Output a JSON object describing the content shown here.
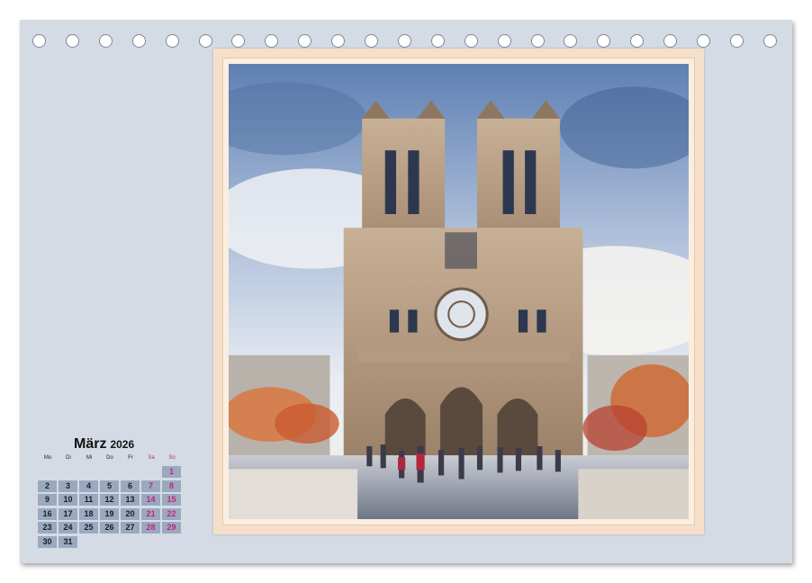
{
  "calendar": {
    "month": "März",
    "year": "2026",
    "weekdays": [
      {
        "label": "Mo",
        "weekend": false
      },
      {
        "label": "Di",
        "weekend": false
      },
      {
        "label": "Mi",
        "weekend": false
      },
      {
        "label": "Do",
        "weekend": false
      },
      {
        "label": "Fr",
        "weekend": false
      },
      {
        "label": "Sa",
        "weekend": true
      },
      {
        "label": "So",
        "weekend": true
      }
    ],
    "first_weekday_index": 6,
    "days_in_month": 31,
    "weekend_color": "#c0267a",
    "day_cell_color": "#9aa9bf"
  },
  "colors": {
    "page_background": "#d5dbe5",
    "frame": "#f6dfc9"
  },
  "binding_holes": 23,
  "photo": {
    "subject": "watercolor-cathedral-illustration"
  }
}
